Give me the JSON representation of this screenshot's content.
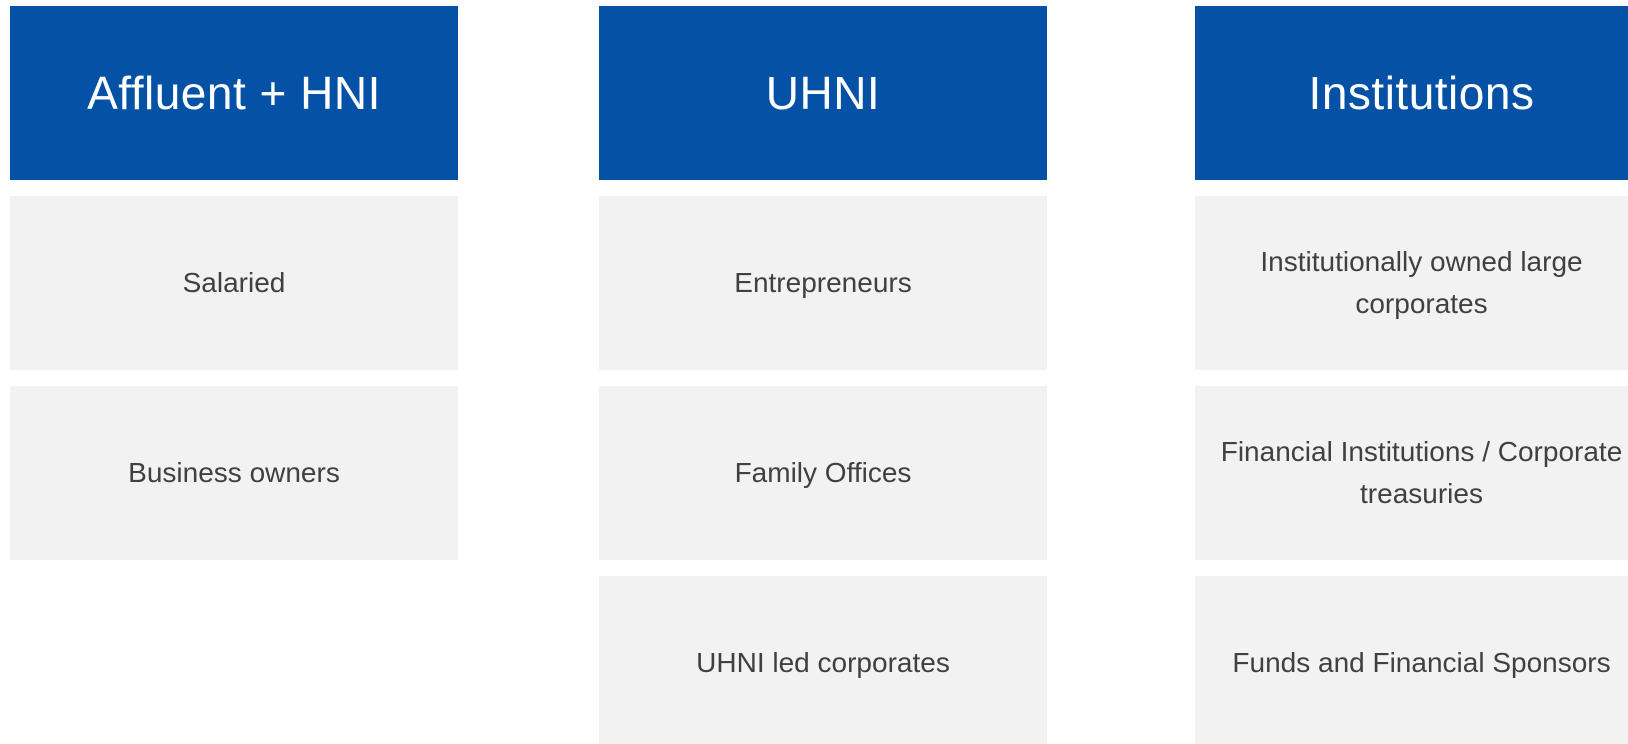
{
  "columns": [
    {
      "title": "Affluent + HNI",
      "items": [
        "Salaried",
        "Business owners"
      ]
    },
    {
      "title": "UHNI",
      "items": [
        "Entrepreneurs",
        "Family Offices",
        "UHNI led corporates"
      ]
    },
    {
      "title": "Institutions",
      "items": [
        "Institutionally owned large corporates",
        "Financial Institutions / Corporate treasuries",
        "Funds and Financial Sponsors"
      ]
    }
  ],
  "colors": {
    "header_bg": "#0451a5",
    "cell_bg": "#f2f2f2",
    "cell_text": "#404040"
  }
}
